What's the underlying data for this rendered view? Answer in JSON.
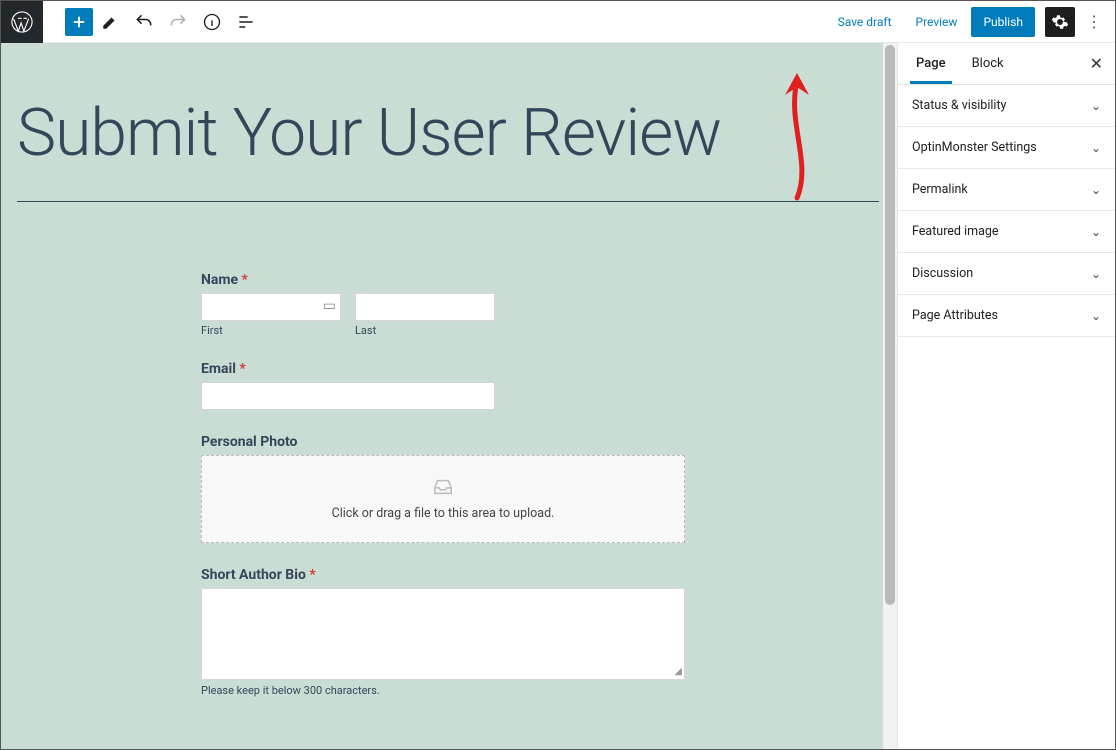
{
  "toolbar": {
    "save_draft": "Save draft",
    "preview": "Preview",
    "publish": "Publish"
  },
  "sidebar": {
    "tabs": {
      "page": "Page",
      "block": "Block"
    },
    "panels": [
      "Status & visibility",
      "OptinMonster Settings",
      "Permalink",
      "Featured image",
      "Discussion",
      "Page Attributes"
    ]
  },
  "page": {
    "title": "Submit Your User Review"
  },
  "form": {
    "name": {
      "label": "Name",
      "first": "First",
      "last": "Last"
    },
    "email": {
      "label": "Email"
    },
    "photo": {
      "label": "Personal Photo",
      "hint": "Click or drag a file to this area to upload."
    },
    "bio": {
      "label": "Short Author Bio",
      "hint": "Please keep it below 300 characters."
    }
  },
  "colors": {
    "accent": "#007cba",
    "canvas": "#c9ddd4"
  }
}
